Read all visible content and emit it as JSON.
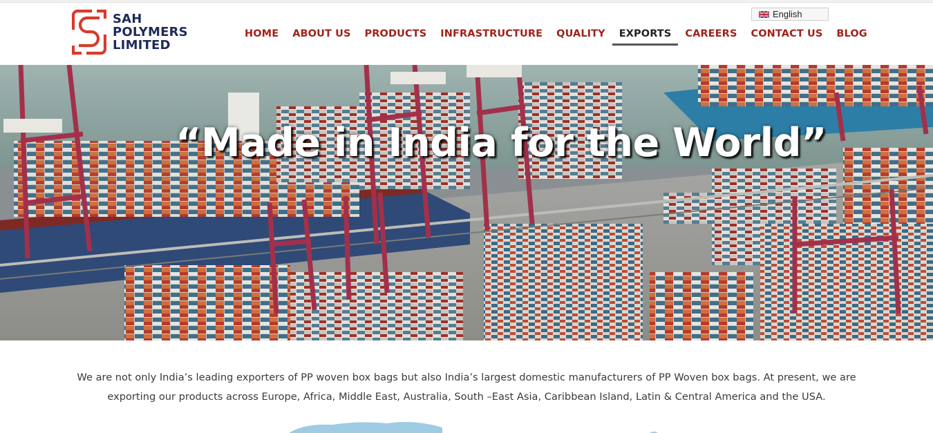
{
  "brand": {
    "line1": "SAH",
    "line2": "POLYMERS",
    "line3": "LIMITED",
    "colors": {
      "logo_red": "#d93a2b",
      "logo_navy": "#1f2a5a"
    }
  },
  "language": {
    "label": "English",
    "flag_icon": "uk-flag-icon"
  },
  "nav": {
    "items": [
      {
        "label": "HOME",
        "active": false
      },
      {
        "label": "ABOUT US",
        "active": false
      },
      {
        "label": "PRODUCTS",
        "active": false
      },
      {
        "label": "INFRASTRUCTURE",
        "active": false
      },
      {
        "label": "QUALITY",
        "active": false
      },
      {
        "label": "EXPORTS",
        "active": true
      },
      {
        "label": "CAREERS",
        "active": false
      },
      {
        "label": "CONTACT US",
        "active": false
      },
      {
        "label": "BLOG",
        "active": false
      }
    ],
    "colors": {
      "link": "#a0221a",
      "active": "#222222"
    }
  },
  "hero": {
    "title": "“Made in India for the World”",
    "image_subject": "aerial-container-port-image"
  },
  "intro": {
    "text": "We are not only India’s leading exporters of PP woven box bags but also India’s largest domestic manufacturers of PP Woven box bags. At present, we are exporting our products across Europe, Africa, Middle East, Australia, South –East Asia, Caribbean Island, Latin & Central America and the USA."
  }
}
